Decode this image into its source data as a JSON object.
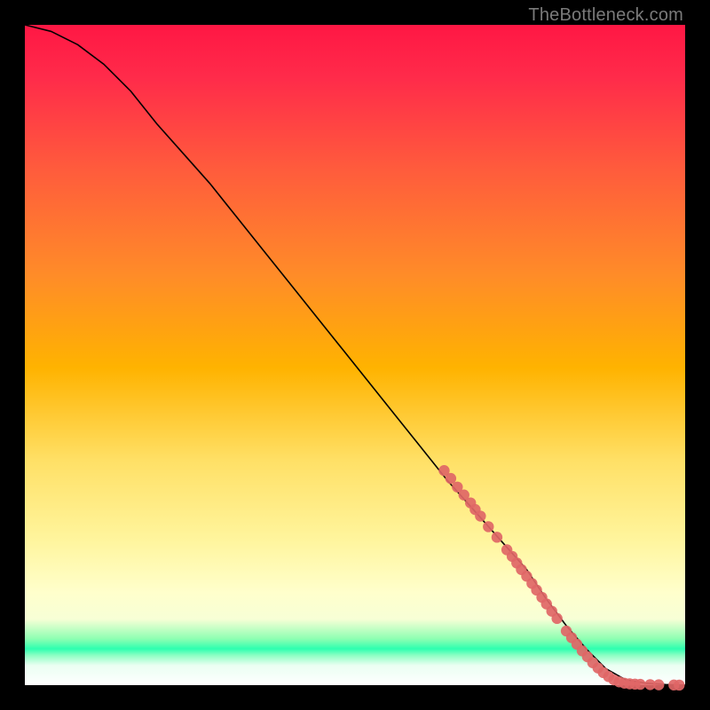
{
  "watermark": "TheBottleneck.com",
  "chart_data": {
    "type": "line",
    "title": "",
    "xlabel": "",
    "ylabel": "",
    "xlim": [
      0,
      100
    ],
    "ylim": [
      0,
      100
    ],
    "grid": false,
    "legend": false,
    "series": [
      {
        "name": "curve",
        "style": "line",
        "color": "#000000",
        "x": [
          0,
          4,
          8,
          12,
          16,
          20,
          24,
          28,
          32,
          36,
          40,
          44,
          48,
          52,
          56,
          60,
          64,
          68,
          72,
          76,
          79,
          82,
          85,
          88,
          91,
          94,
          97,
          100
        ],
        "y": [
          100,
          99,
          97,
          94,
          90,
          85,
          80.5,
          76,
          71,
          66,
          61,
          56,
          51,
          46,
          41,
          36,
          31,
          26.5,
          22,
          17.5,
          13,
          9,
          5.5,
          2.5,
          0.8,
          0.3,
          0.1,
          0.0
        ]
      },
      {
        "name": "markers",
        "style": "points",
        "color": "#e06666",
        "points": [
          {
            "x": 63.5,
            "y": 32.5
          },
          {
            "x": 64.5,
            "y": 31.3
          },
          {
            "x": 65.5,
            "y": 30.0
          },
          {
            "x": 66.5,
            "y": 28.8
          },
          {
            "x": 67.5,
            "y": 27.6
          },
          {
            "x": 68.2,
            "y": 26.6
          },
          {
            "x": 69.0,
            "y": 25.6
          },
          {
            "x": 70.2,
            "y": 24.0
          },
          {
            "x": 71.5,
            "y": 22.4
          },
          {
            "x": 73.0,
            "y": 20.5
          },
          {
            "x": 73.8,
            "y": 19.5
          },
          {
            "x": 74.5,
            "y": 18.5
          },
          {
            "x": 75.2,
            "y": 17.5
          },
          {
            "x": 76.0,
            "y": 16.5
          },
          {
            "x": 76.8,
            "y": 15.4
          },
          {
            "x": 77.5,
            "y": 14.4
          },
          {
            "x": 78.3,
            "y": 13.3
          },
          {
            "x": 79.0,
            "y": 12.3
          },
          {
            "x": 79.8,
            "y": 11.2
          },
          {
            "x": 80.6,
            "y": 10.1
          },
          {
            "x": 82.0,
            "y": 8.2
          },
          {
            "x": 82.8,
            "y": 7.2
          },
          {
            "x": 83.6,
            "y": 6.2
          },
          {
            "x": 84.4,
            "y": 5.2
          },
          {
            "x": 85.2,
            "y": 4.3
          },
          {
            "x": 86.0,
            "y": 3.4
          },
          {
            "x": 86.8,
            "y": 2.6
          },
          {
            "x": 87.6,
            "y": 1.9
          },
          {
            "x": 88.4,
            "y": 1.3
          },
          {
            "x": 89.2,
            "y": 0.8
          },
          {
            "x": 90.0,
            "y": 0.5
          },
          {
            "x": 90.8,
            "y": 0.3
          },
          {
            "x": 91.6,
            "y": 0.2
          },
          {
            "x": 92.4,
            "y": 0.15
          },
          {
            "x": 93.2,
            "y": 0.12
          },
          {
            "x": 94.7,
            "y": 0.08
          },
          {
            "x": 96.0,
            "y": 0.05
          },
          {
            "x": 98.3,
            "y": 0.02
          },
          {
            "x": 99.1,
            "y": 0.01
          }
        ]
      }
    ]
  }
}
